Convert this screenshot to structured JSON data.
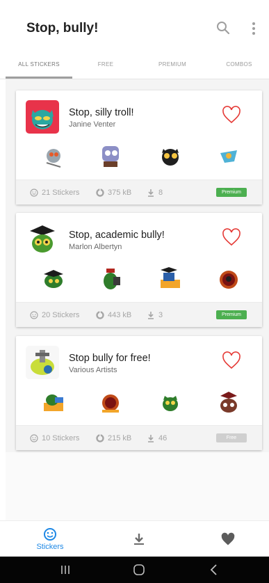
{
  "appbar": {
    "title": "Stop, bully!",
    "search_icon": "search-icon",
    "more_icon": "more-vert-icon"
  },
  "tabs": [
    {
      "label": "ALL STICKERS",
      "active": true
    },
    {
      "label": "FREE",
      "active": false
    },
    {
      "label": "PREMIUM",
      "active": false
    },
    {
      "label": "COMBOS",
      "active": false
    }
  ],
  "packs": [
    {
      "title": "Stop, silly troll!",
      "author": "Janine Venter",
      "stickers_count": "21 Stickers",
      "size": "375 kB",
      "downloads": "8",
      "badge": "Premium",
      "badge_color": "#4caf50"
    },
    {
      "title": "Stop, academic bully!",
      "author": "Marlon Albertyn",
      "stickers_count": "20 Stickers",
      "size": "443 kB",
      "downloads": "3",
      "badge": "Premium",
      "badge_color": "#4caf50"
    },
    {
      "title": "Stop bully for free!",
      "author": "Various Artists",
      "stickers_count": "10 Stickers",
      "size": "215 kB",
      "downloads": "46",
      "badge": "Free",
      "badge_color": "#cfcfcf"
    }
  ],
  "bottom_nav": [
    {
      "label": "Stickers",
      "icon": "smiley-icon",
      "active": true
    },
    {
      "label": "",
      "icon": "download-icon",
      "active": false
    },
    {
      "label": "",
      "icon": "heart-icon",
      "active": false
    }
  ],
  "colors": {
    "accent": "#1e88e5",
    "heart": "#e53935",
    "premium": "#4caf50",
    "free": "#cfcfcf"
  }
}
